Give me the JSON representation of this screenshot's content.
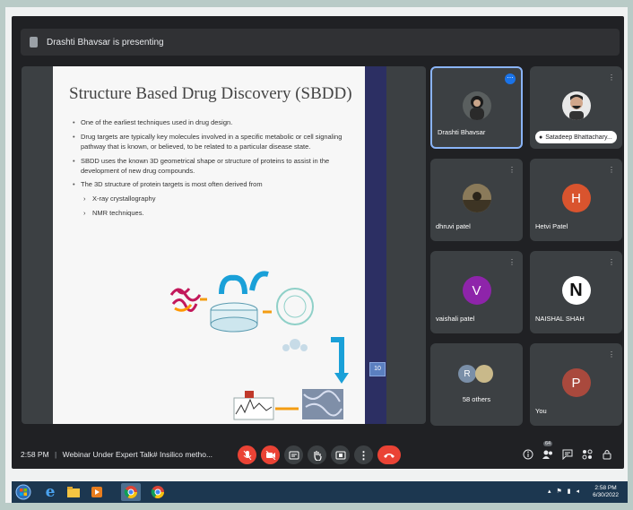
{
  "presenting": {
    "text": "Drashti Bhavsar is presenting"
  },
  "slide": {
    "title": "Structure Based Drug Discovery (SBDD)",
    "bullets": [
      "One of the earliest techniques used in drug design.",
      "Drug targets are typically key molecules involved in a specific metabolic or cell signaling pathway that is known, or believed, to be related to a particular disease state.",
      "SBDD uses the known 3D geometrical shape or structure of proteins to assist in the development of new drug compounds.",
      "The 3D structure of protein targets is most often derived from"
    ],
    "sub_bullets": [
      "X-ray crystallography",
      "NMR techniques."
    ],
    "page_label": "10"
  },
  "participants": [
    {
      "name": "Drashti Bhavsar",
      "initial": "",
      "color": "#5a5f5f",
      "speaking": true
    },
    {
      "name": "Satadeep Bhattachary...",
      "initial": "",
      "color": "#e8e8e8",
      "speaking": false
    },
    {
      "name": "dhruvi patel",
      "initial": "",
      "color": "#6b5a3e",
      "speaking": false
    },
    {
      "name": "Hetvi Patel",
      "initial": "H",
      "color": "#d9542e",
      "speaking": false
    },
    {
      "name": "vaishali patel",
      "initial": "V",
      "color": "#8e24aa",
      "speaking": false
    },
    {
      "name": "NAISHAL SHAH",
      "initial": "N",
      "color": "#ffffff",
      "speaking": false
    },
    {
      "name": "58 others",
      "initial": "R",
      "color": "#7a8fa8",
      "speaking": false
    },
    {
      "name": "You",
      "initial": "P",
      "color": "#a9493d",
      "speaking": false
    }
  ],
  "bottom_bar": {
    "time": "2:58 PM",
    "meeting_title": "Webinar Under Expert Talk# Insilico metho...",
    "people_count": "64"
  },
  "taskbar": {
    "clock_time": "2:58 PM",
    "clock_date": "6/30/2022"
  },
  "colors": {
    "meet_bg": "#202124",
    "tile_bg": "#3c4043",
    "end_call": "#ea4335",
    "speaking_border": "#8ab4f8"
  }
}
